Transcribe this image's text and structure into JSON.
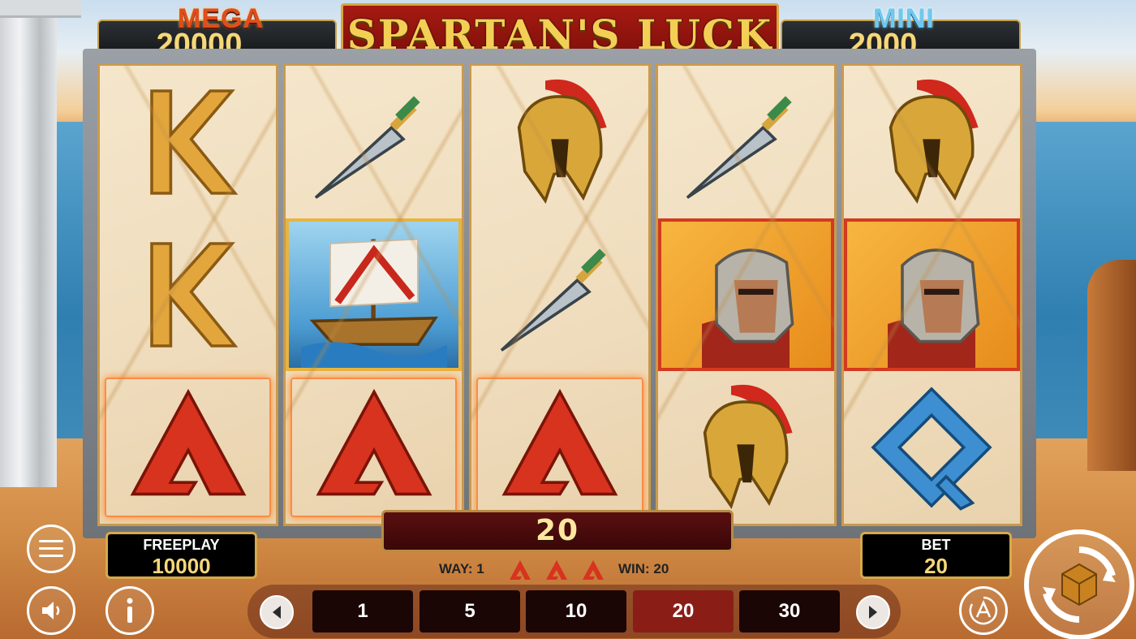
{
  "jackpots": {
    "mega": {
      "label": "MEGA",
      "value": "20000"
    },
    "mini": {
      "label": "MINI",
      "value": "2000"
    }
  },
  "logo": {
    "title": "SPARTAN'S LUCK"
  },
  "reels": [
    [
      "letter-k",
      "letter-k",
      "letter-a"
    ],
    [
      "sword",
      "ship",
      "letter-a"
    ],
    [
      "helmet",
      "sword",
      "letter-a"
    ],
    [
      "sword",
      "spartan-warrior",
      "helmet"
    ],
    [
      "helmet",
      "spartan-warrior",
      "letter-q"
    ]
  ],
  "win_amount": "20",
  "way_line": {
    "way_label": "WAY: 1",
    "win_label": "WIN: 20"
  },
  "freeplay": {
    "label": "FREEPLAY",
    "value": "10000"
  },
  "bet": {
    "label": "BET",
    "value": "20"
  },
  "bet_options": [
    "1",
    "5",
    "10",
    "20",
    "30"
  ],
  "selected_bet": "20",
  "colors": {
    "frame_gold": "#d7a94a",
    "selected_bet": "#8a1e17",
    "logo_red": "#a61a12"
  }
}
